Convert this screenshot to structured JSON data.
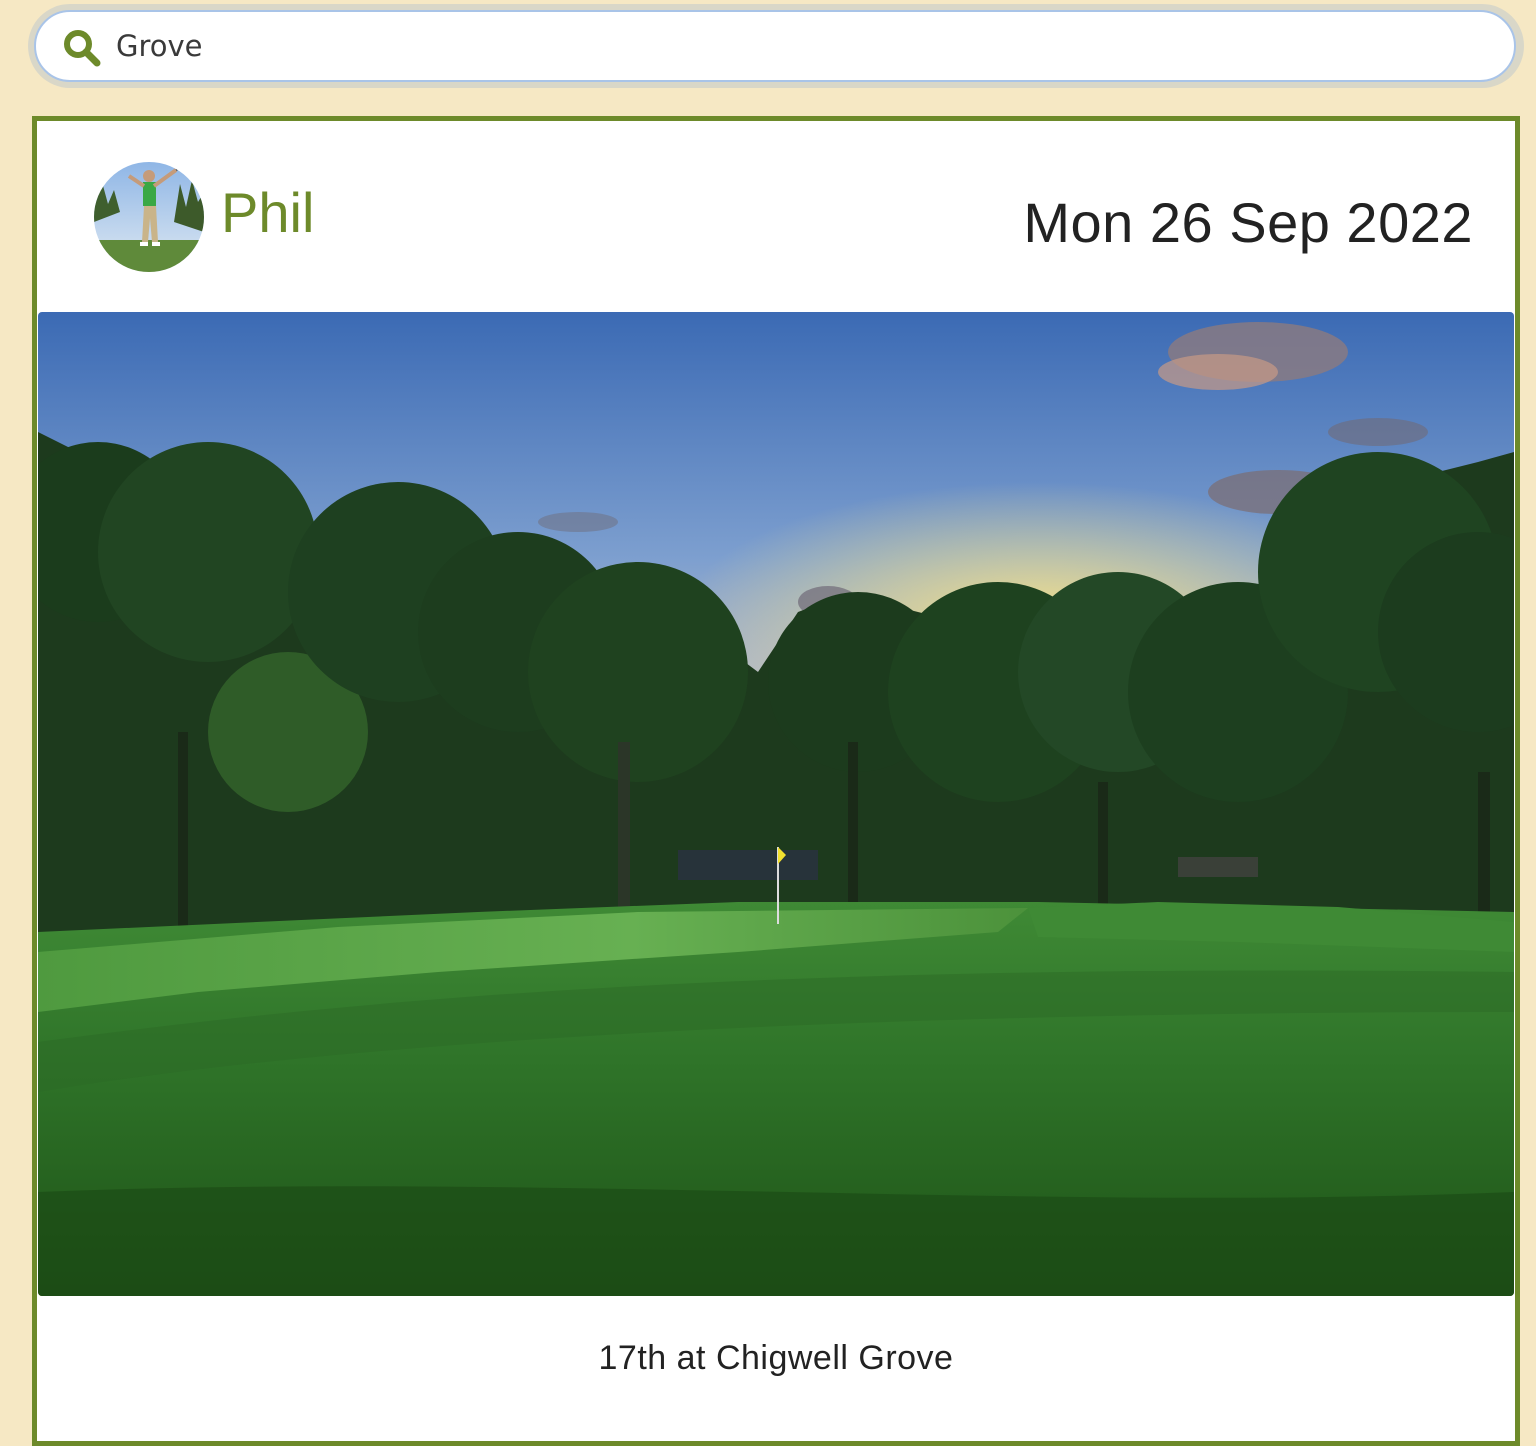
{
  "search": {
    "value": "Grove",
    "icon": "search-icon"
  },
  "colors": {
    "page_background": "#f6e8c4",
    "accent_green": "#6d8a2a",
    "search_border": "#a9c4e8"
  },
  "post": {
    "author": "Phil",
    "date": "Mon 26 Sep 2022",
    "caption": "17th at Chigwell Grove",
    "avatar_icon": "golfer-avatar",
    "photo_subject": "golf-course-green-at-dusk"
  }
}
